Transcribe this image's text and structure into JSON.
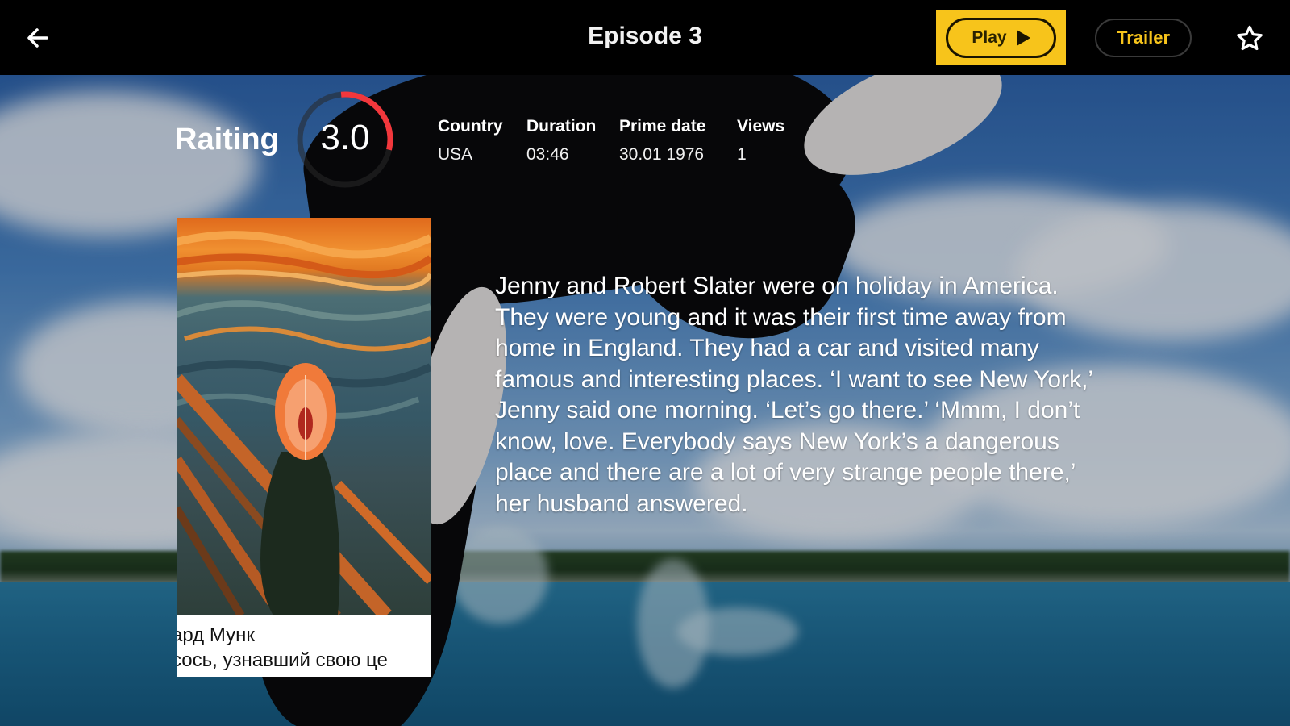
{
  "header": {
    "title": "Episode 3",
    "play_label": "Play",
    "trailer_label": "Trailer",
    "icons": [
      "arrow-left-icon",
      "play-triangle-icon",
      "star-outline-icon"
    ]
  },
  "rating": {
    "label": "Raiting",
    "value": "3.0",
    "gauge_fraction": 0.3,
    "gauge_color": "#f2373c"
  },
  "meta": [
    {
      "key": "Country",
      "value": "USA"
    },
    {
      "key": "Duration",
      "value": "03:46"
    },
    {
      "key": "Prime date",
      "value": "30.01 1976"
    },
    {
      "key": "Views",
      "value": "1"
    }
  ],
  "poster": {
    "caption_line1": "ард Мунк",
    "caption_line2": "сось, узнавший свою це"
  },
  "description": "Jenny and Robert Slater were on holiday in America. They were young and it was their first time away from home in England. They had a car and visited many famous and interesting places. ‘I want to see New York,’ Jenny said one morning. ‘Let’s go there.’ ‘Mmm, I don’t know, love. Everybody says New York’s a dangerous place and there are a lot of very strange people there,’ her husband answered.",
  "colors": {
    "accent": "#f7c41b",
    "topbar": "#000000"
  }
}
